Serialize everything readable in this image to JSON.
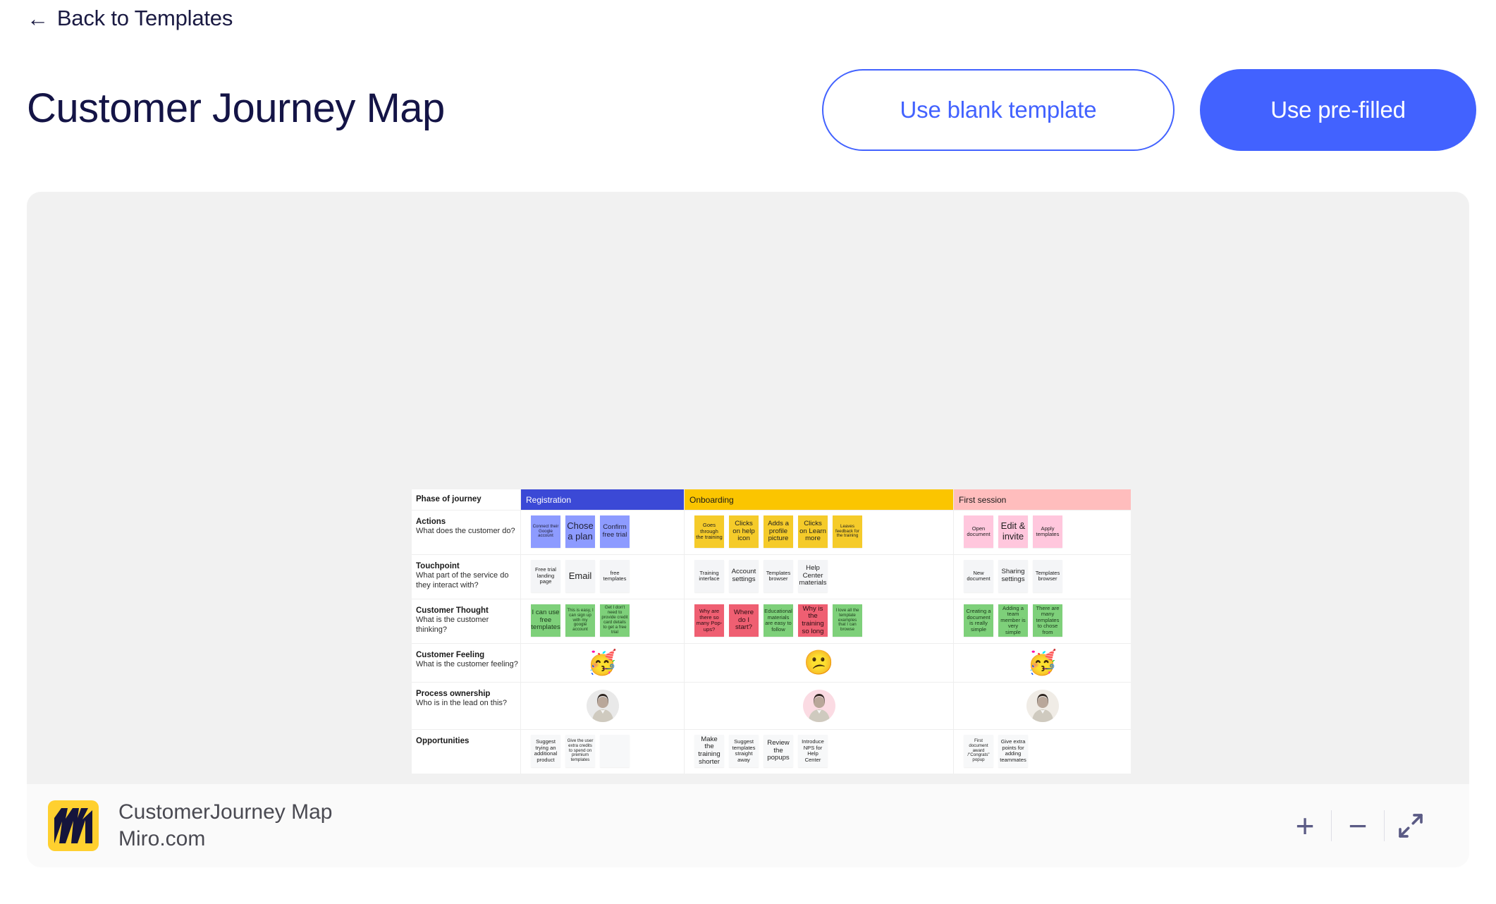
{
  "header": {
    "back_label": "Back to Templates",
    "back_arrow": "←",
    "title": "Customer Journey Map",
    "use_blank_label": "Use blank template",
    "use_prefilled_label": "Use pre-filled",
    "accent_color": "#4262ff",
    "title_color": "#141446"
  },
  "footer": {
    "title": "CustomerJourney Map",
    "subtitle": "Miro.com",
    "logo_color": "#ffd02f",
    "zoom_in": "+",
    "zoom_out": "−"
  },
  "map": {
    "phase_label": "Phase of journey",
    "phases": [
      {
        "name": "Registration",
        "color": "#3b49d6"
      },
      {
        "name": "Onboarding",
        "color": "#fbc500"
      },
      {
        "name": "First session",
        "color": "#ffbdbd"
      }
    ],
    "rows": [
      {
        "title": "Actions",
        "subtitle": "What does the customer do?",
        "registration": [
          {
            "text": "Connect their Google account",
            "style": "blue",
            "size": "xs"
          },
          {
            "text": "Chose a plan",
            "style": "blue",
            "size": "l"
          },
          {
            "text": "Confirm free trial",
            "style": "blue",
            "size": "m"
          }
        ],
        "onboarding": [
          {
            "text": "Goes through the training",
            "style": "yellow",
            "size": "s"
          },
          {
            "text": "Clicks on help icon",
            "style": "yellow",
            "size": "m"
          },
          {
            "text": "Adds a profile picture",
            "style": "yellow",
            "size": "m"
          },
          {
            "text": "Clicks on Learn more",
            "style": "yellow",
            "size": "m"
          },
          {
            "text": "Leaves feedback for the training",
            "style": "yellow",
            "size": "xs"
          }
        ],
        "first_session": [
          {
            "text": "Open document",
            "style": "pink",
            "size": "s"
          },
          {
            "text": "Edit & invite",
            "style": "pink",
            "size": "l"
          },
          {
            "text": "Apply templates",
            "style": "pink",
            "size": "s"
          }
        ]
      },
      {
        "title": "Touchpoint",
        "subtitle": "What part of the service do they interact with?",
        "registration": [
          {
            "text": "Free trial landing page",
            "style": "gray",
            "size": "s"
          },
          {
            "text": "Email",
            "style": "gray",
            "size": "l"
          },
          {
            "text": "free templates",
            "style": "gray",
            "size": "s"
          }
        ],
        "onboarding": [
          {
            "text": "Training interface",
            "style": "gray",
            "size": "s"
          },
          {
            "text": "Account settings",
            "style": "gray",
            "size": "m"
          },
          {
            "text": "Templates browser",
            "style": "gray",
            "size": "s"
          },
          {
            "text": "Help Center materials",
            "style": "gray",
            "size": "m"
          }
        ],
        "first_session": [
          {
            "text": "New document",
            "style": "gray",
            "size": "s"
          },
          {
            "text": "Sharing settings",
            "style": "gray",
            "size": "m"
          },
          {
            "text": "Templates browser",
            "style": "gray",
            "size": "s"
          }
        ]
      },
      {
        "title": "Customer Thought",
        "subtitle": "What is the customer thinking?",
        "registration": [
          {
            "text": "I can use free templates",
            "style": "green",
            "size": "m"
          },
          {
            "text": "This is easy, I can sign up with my google account",
            "style": "green",
            "size": "xs"
          },
          {
            "text": "Get I don't need to provide credit card details to get a free trial",
            "style": "green",
            "size": "xs"
          }
        ],
        "onboarding": [
          {
            "text": "Why are there so many Pop-ups?",
            "style": "red",
            "size": "s"
          },
          {
            "text": "Where do I start?",
            "style": "red",
            "size": "m"
          },
          {
            "text": "Educational materials are easy to follow",
            "style": "green",
            "size": "s"
          },
          {
            "text": "Why is the training so long",
            "style": "red",
            "size": "m"
          },
          {
            "text": "I love all the template examples that I can browse",
            "style": "green",
            "size": "xs"
          }
        ],
        "first_session": [
          {
            "text": "Creating a document is really simple",
            "style": "green",
            "size": "s"
          },
          {
            "text": "Adding a team member is very simple",
            "style": "green",
            "size": "s"
          },
          {
            "text": "There are many templates to chose from",
            "style": "green",
            "size": "s"
          }
        ]
      },
      {
        "title": "Customer Feeling",
        "subtitle": "What is the customer feeling?",
        "registration_emoji": "🥳",
        "onboarding_emoji": "😕",
        "first_session_emoji": "🥳"
      },
      {
        "title": "Process ownership",
        "subtitle": "Who is in the lead on this?",
        "registration_avatar": "avatar-person-1",
        "onboarding_avatar": "avatar-person-2",
        "first_session_avatar": "avatar-person-3"
      },
      {
        "title": "Opportunities",
        "subtitle": "",
        "registration": [
          {
            "text": "Suggest trying an additional product",
            "style": "white",
            "size": "s"
          },
          {
            "text": "Give the user extra credits to spend on premium templates",
            "style": "white",
            "size": "xs"
          },
          {
            "text": "",
            "style": "white",
            "size": "s"
          }
        ],
        "onboarding": [
          {
            "text": "Make the training shorter",
            "style": "white",
            "size": "m"
          },
          {
            "text": "Suggest templates straight away",
            "style": "white",
            "size": "s"
          },
          {
            "text": "Review the popups",
            "style": "white",
            "size": "m"
          },
          {
            "text": "Introduce NPS for Help Center",
            "style": "white",
            "size": "s"
          }
        ],
        "first_session": [
          {
            "text": "First document award /\"Congrats\" popup",
            "style": "white",
            "size": "xs"
          },
          {
            "text": "Give extra points for adding teammates",
            "style": "white",
            "size": "s"
          }
        ]
      }
    ]
  }
}
